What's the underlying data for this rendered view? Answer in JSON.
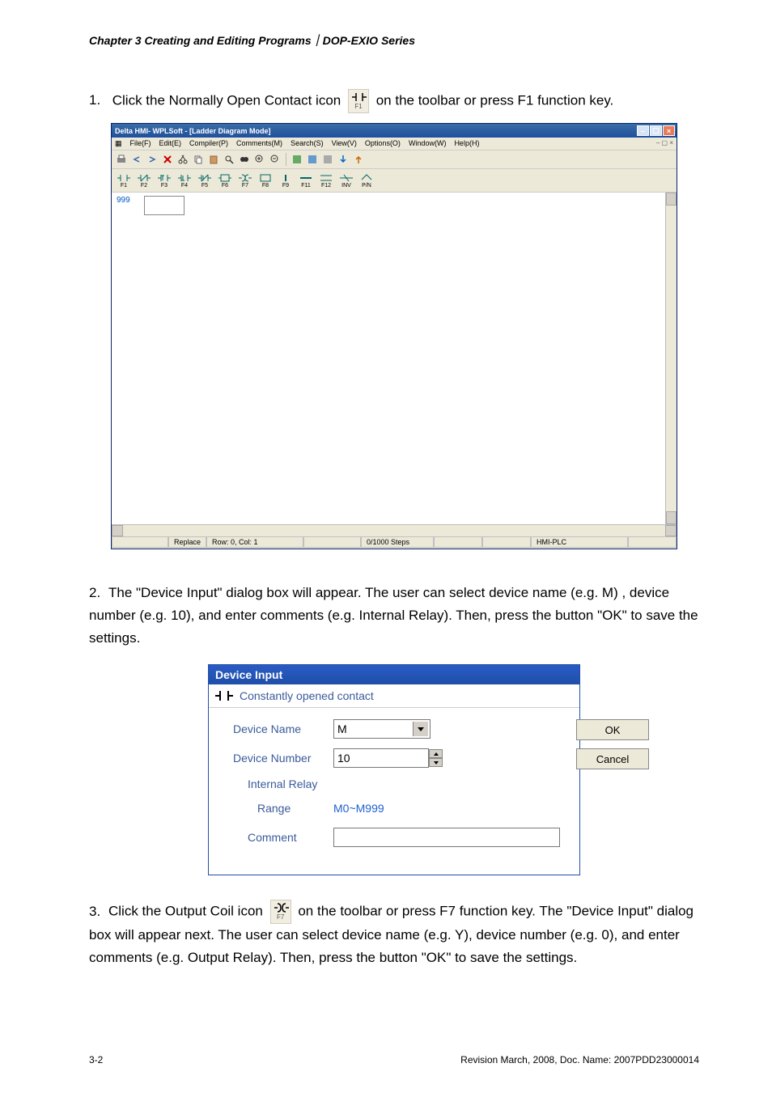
{
  "header": "Chapter 3 Creating and Editing Programs｜DOP-EXIO Series",
  "step1": {
    "num": "1.",
    "text_a": "Click the Normally Open Contact icon",
    "text_b": "on the toolbar or press F1 function key.",
    "icon_f": "F1"
  },
  "app": {
    "title": "Delta HMI- WPLSoft - [Ladder Diagram Mode]",
    "menu": [
      "File(F)",
      "Edit(E)",
      "Compiler(P)",
      "Comments(M)",
      "Search(S)",
      "View(V)",
      "Options(O)",
      "Window(W)",
      "Help(H)"
    ],
    "inner_ctrl": "– ▢ ×",
    "row_num": "999",
    "status": {
      "replace": "Replace",
      "rowcol": "Row: 0, Col: 1",
      "steps": "0/1000 Steps",
      "right": "HMI-PLC"
    }
  },
  "step2": {
    "num": "2.",
    "text": "The \"Device Input\" dialog box will appear. The user can select device name (e.g. M) , device number (e.g. 10), and enter comments (e.g. Internal Relay). Then, press the button \"OK\" to save the settings."
  },
  "dialog": {
    "title": "Device Input",
    "subtitle": "Constantly opened contact",
    "device_name_label": "Device Name",
    "device_name_value": "M",
    "device_number_label": "Device Number",
    "device_number_value": "10",
    "internal_relay": "Internal Relay",
    "range_label": "Range",
    "range_value": "M0~M999",
    "comment_label": "Comment",
    "ok": "OK",
    "cancel": "Cancel"
  },
  "step3": {
    "num": "3.",
    "text_a": "Click the Output Coil icon",
    "icon_f": "F7",
    "text_b": "on the toolbar or press F7 function key. The \"Device Input\" dialog box will appear next. The user can select device name (e.g. Y), device number (e.g. 0), and enter comments (e.g. Output Relay). Then, press the button \"OK\" to save the settings."
  },
  "footer": {
    "left": "3-2",
    "right": "Revision March, 2008, Doc. Name: 2007PDD23000014"
  }
}
